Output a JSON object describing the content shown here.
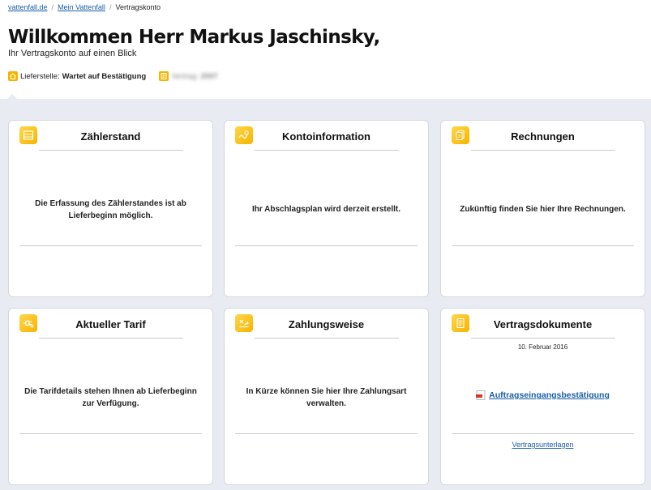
{
  "breadcrumb": {
    "home": "vattenfall.de",
    "mine": "Mein Vattenfall",
    "current": "Vertragskonto",
    "sep": "/"
  },
  "header": {
    "title": "Willkommen Herr Markus Jaschinsky,",
    "subtitle": "Ihr Vertragskonto auf einen Blick"
  },
  "status": {
    "delivery_label": "Lieferstelle:",
    "delivery_value": "Wartet auf Bestätigung",
    "contract_label": "Vertrag:",
    "contract_value": "2007",
    "accent": "#f6b400"
  },
  "cards": {
    "meter": {
      "title": "Zählerstand",
      "text": "Die Erfassung des Zählerstandes ist ab Lieferbeginn möglich.",
      "icon": "meter-icon"
    },
    "account": {
      "title": "Kontoinformation",
      "text": "Ihr Abschlagsplan wird derzeit erstellt.",
      "icon": "account-chart-icon"
    },
    "invoices": {
      "title": "Rechnungen",
      "text": "Zukünftig finden Sie hier Ihre Rechnungen.",
      "icon": "invoices-icon"
    },
    "tariff": {
      "title": "Aktueller Tarif",
      "text": "Die Tarifdetails stehen Ihnen ab Lieferbeginn zur Verfügung.",
      "icon": "plug-icon"
    },
    "payment": {
      "title": "Zahlungsweise",
      "text": "In Kürze können Sie hier Ihre Zahlungsart verwalten.",
      "icon": "payment-icon"
    },
    "documents": {
      "title": "Vertragsdokumente",
      "date": "10. Februar 2016",
      "link": "Auftragseingangsbestätigung",
      "footer_link": "Vertragsunterlagen",
      "icon": "documents-icon"
    }
  }
}
